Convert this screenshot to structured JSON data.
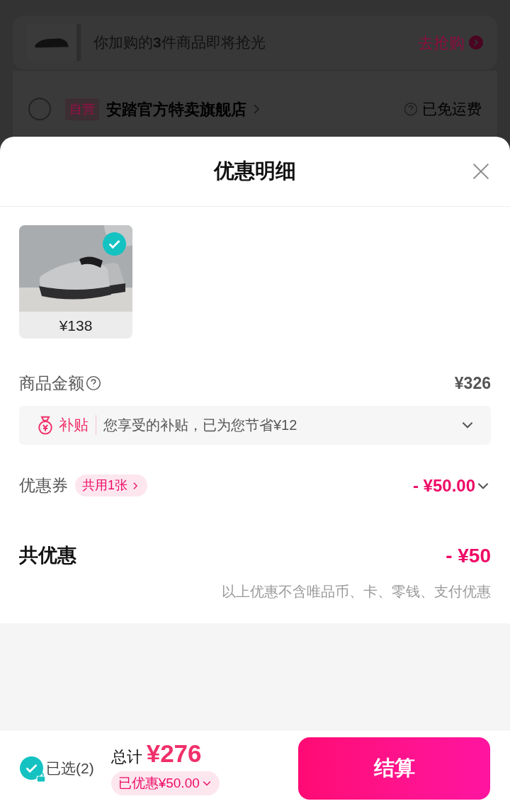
{
  "background": {
    "banner": {
      "text": "你加购的**3**件商品即将抢光",
      "action": "去抢购"
    },
    "store": {
      "checked": false,
      "tag": "自营",
      "name": "安踏官方特卖旗舰店",
      "shipping": "已免运费"
    }
  },
  "sheet": {
    "title": "优惠明细",
    "products": [
      {
        "kind": "picture",
        "price": "¥138",
        "selected": true
      }
    ],
    "goods_amount": {
      "label": "商品金额",
      "value": "¥326"
    },
    "subsidy": {
      "tag": "补贴",
      "text": "您享受的补贴，已为您节省¥12",
      "expanded": false
    },
    "coupon": {
      "label": "优惠券",
      "badge": "共用1张",
      "value": "- ¥50.00"
    },
    "total_discount": {
      "label": "共优惠",
      "value": "- ¥50",
      "note": "以上优惠不含唯品币、卡、零钱、支付优惠"
    }
  },
  "footer": {
    "select_all": {
      "checked": true,
      "label": "已选(2)"
    },
    "total_label": "总计",
    "total": "¥276",
    "discount": "已优惠¥50.00",
    "checkout": "结算"
  }
}
